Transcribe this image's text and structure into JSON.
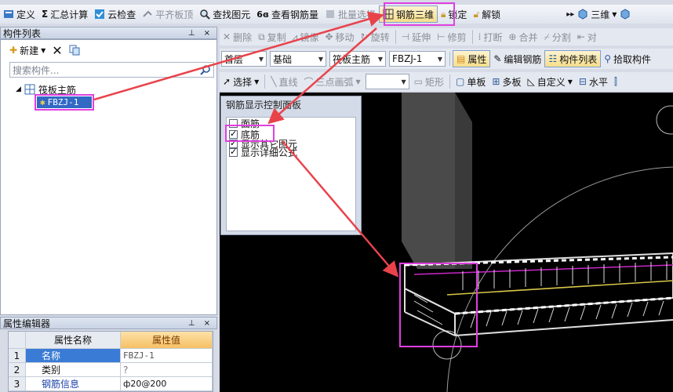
{
  "top_toolbar": {
    "define": "定义",
    "summary_calc": "汇总计算",
    "cloud_check": "云检查",
    "flat_slab_top": "平齐板顶",
    "find_element": "查找图元",
    "view_rebar_qty": "查看钢筋量",
    "batch_select": "批量选择",
    "rebar_3d": "钢筋三维",
    "lock": "锁定",
    "unlock": "解锁",
    "view_3d": "三维"
  },
  "edit_toolbar": {
    "delete": "删除",
    "copy": "复制",
    "mirror": "镜像",
    "move": "移动",
    "rotate": "旋转",
    "extend": "延伸",
    "trim": "修剪",
    "break": "打断",
    "merge": "合并",
    "split": "分割",
    "align": "对"
  },
  "attr_toolbar": {
    "floor": "首层",
    "category": "基础",
    "type": "筏板主筋",
    "element": "FBZJ-1",
    "properties": "属性",
    "edit_rebar": "编辑钢筋",
    "element_list": "构件列表",
    "pick_element": "拾取构件"
  },
  "draw_toolbar": {
    "select": "选择",
    "straight": "直线",
    "three_point_arc": "三点画弧",
    "rect": "矩形",
    "single_slab": "单板",
    "multi_slab": "多板",
    "custom": "自定义",
    "horizontal": "水平"
  },
  "element_list": {
    "title": "构件列表",
    "pin_close": "⊥ ×",
    "new_label": "新建",
    "search_placeholder": "搜索构件...",
    "tree_group": "筏板主筋",
    "tree_item": "FBZJ-1"
  },
  "property_editor": {
    "title": "属性编辑器",
    "pin_close": "⊥ ×",
    "col_name": "属性名称",
    "col_value": "属性值",
    "rows": [
      {
        "index": "1",
        "name": "名称",
        "value": "FBZJ-1"
      },
      {
        "index": "2",
        "name": "类别",
        "value": "?"
      },
      {
        "index": "3",
        "name": "钢筋信息",
        "value": "ф20@200"
      }
    ]
  },
  "control_panel": {
    "title": "钢筋显示控制面板",
    "options": [
      {
        "label": "面筋",
        "checked": false
      },
      {
        "label": "底筋",
        "checked": true
      },
      {
        "label": "显示其它图元",
        "checked": true
      },
      {
        "label": "显示详细公式",
        "checked": true
      }
    ]
  },
  "colors": {
    "highlight": "#e040e0",
    "arrow": "#e8434b",
    "viewport_bg": "#000000",
    "rebar_line": "#c828c8",
    "slab_edge": "#e0e0e0",
    "gold_line": "#d8c84a"
  }
}
